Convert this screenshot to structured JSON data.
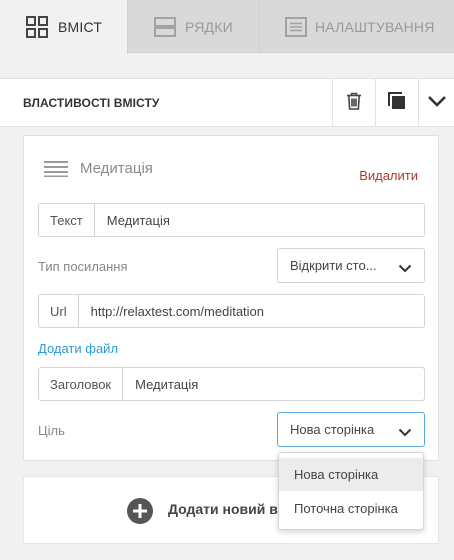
{
  "tabs": [
    {
      "label": "ВМІСТ",
      "icon": "grid-icon",
      "active": true
    },
    {
      "label": "РЯДКИ",
      "icon": "rows-icon",
      "active": false
    },
    {
      "label": "НАЛАШТУВАННЯ",
      "icon": "settings-doc-icon",
      "active": false
    }
  ],
  "properties": {
    "title": "ВЛАСТИВОСТІ ВМІСТУ",
    "actions": [
      "trash-icon",
      "copy-icon",
      "chevron-down-icon"
    ]
  },
  "item": {
    "title": "Медитація",
    "remove_label": "Видалити",
    "text_label": "Текст",
    "text_value": "Медитація",
    "link_type_label": "Тип посилання",
    "link_type_value": "Відкрити сто...",
    "url_label": "Url",
    "url_value": "http://relaxtest.com/meditation",
    "add_file_label": "Додати файл",
    "heading_label": "Заголовок",
    "heading_value": "Медитація",
    "target_label": "Ціль",
    "target_value": "Нова сторінка"
  },
  "add_content": {
    "label": "Додати новий в"
  },
  "target_dropdown": {
    "options": [
      "Нова сторінка",
      "Поточна сторінка"
    ],
    "highlighted_index": 0
  },
  "colors": {
    "remove": "#b0392e",
    "link": "#2d9ad8",
    "focus": "#5aa8d8"
  }
}
